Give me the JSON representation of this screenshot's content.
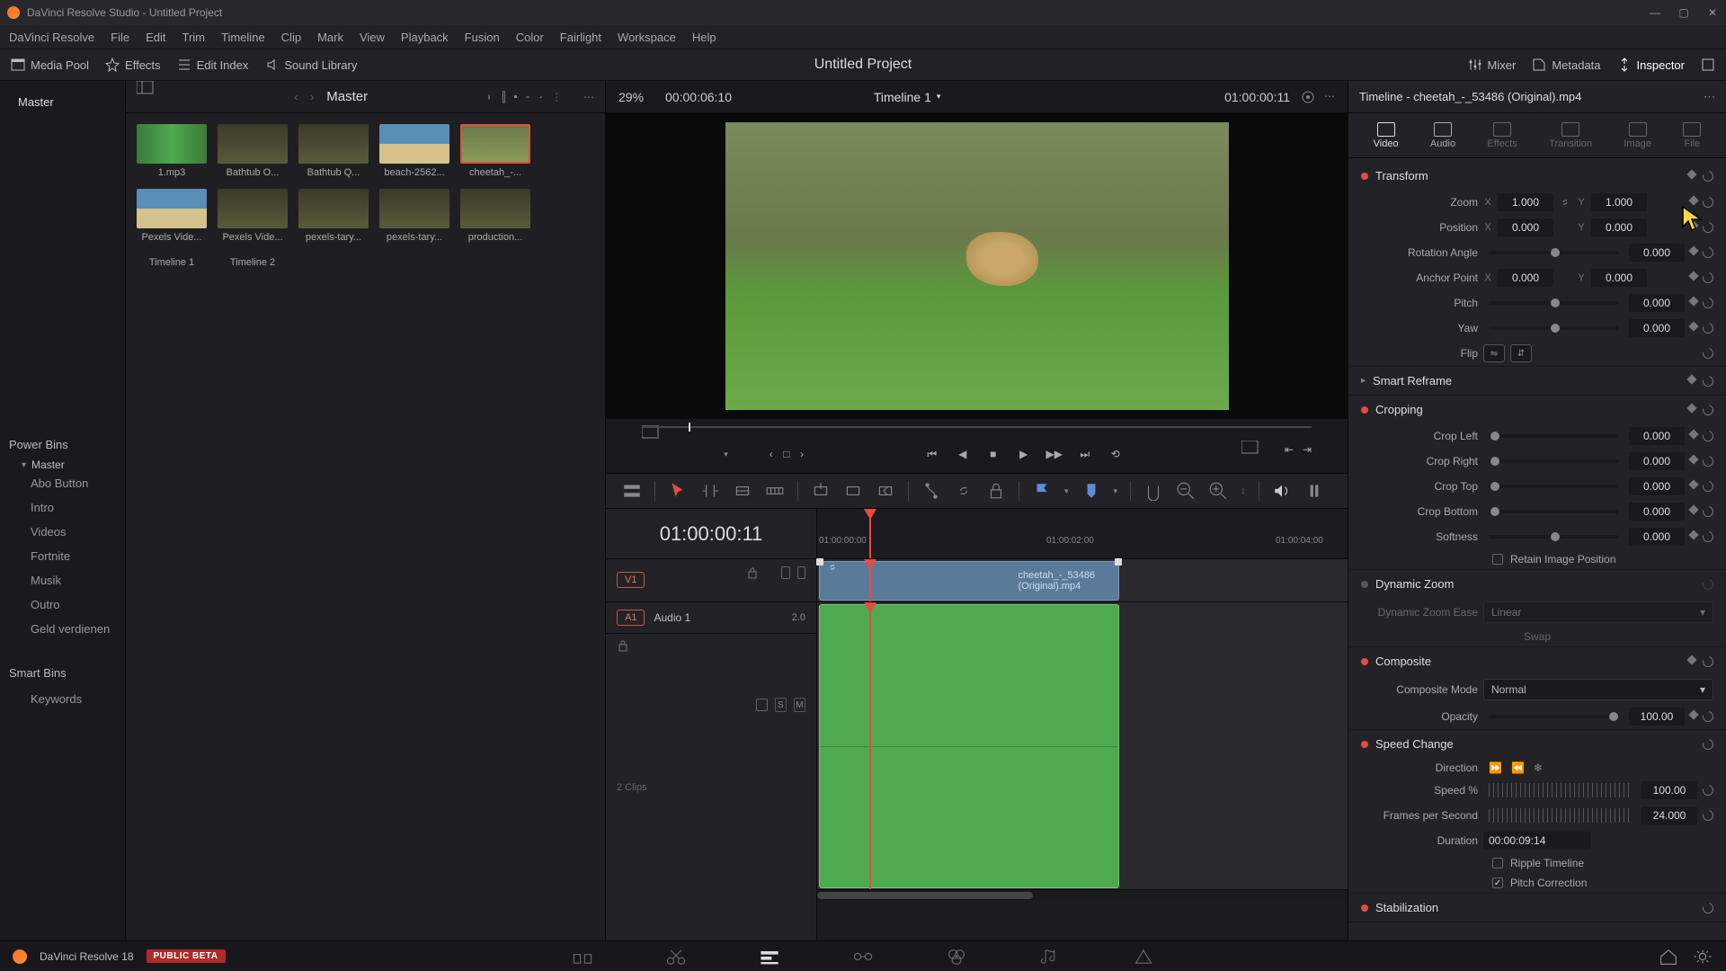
{
  "titlebar": {
    "text": "DaVinci Resolve Studio - Untitled Project"
  },
  "menu": [
    "DaVinci Resolve",
    "File",
    "Edit",
    "Trim",
    "Timeline",
    "Clip",
    "Mark",
    "View",
    "Playback",
    "Fusion",
    "Color",
    "Fairlight",
    "Workspace",
    "Help"
  ],
  "toolbar": {
    "media_pool": "Media Pool",
    "effects": "Effects",
    "edit_index": "Edit Index",
    "sound_library": "Sound Library",
    "mixer": "Mixer",
    "metadata": "Metadata",
    "inspector": "Inspector"
  },
  "project_title": "Untitled Project",
  "media": {
    "breadcrumb": "Master",
    "master_label": "Master",
    "clips": [
      {
        "name": "1.mp3",
        "kind": "audio"
      },
      {
        "name": "Bathtub O...",
        "kind": "forest"
      },
      {
        "name": "Bathtub Q...",
        "kind": "forest"
      },
      {
        "name": "beach-2562...",
        "kind": "beach"
      },
      {
        "name": "cheetah_-...",
        "kind": "cheetah"
      },
      {
        "name": "Pexels Vide...",
        "kind": "beach"
      },
      {
        "name": "Pexels Vide...",
        "kind": "forest"
      },
      {
        "name": "pexels-tary...",
        "kind": "forest"
      },
      {
        "name": "pexels-tary...",
        "kind": "forest"
      },
      {
        "name": "production...",
        "kind": "forest"
      },
      {
        "name": "Timeline 1",
        "kind": "timeline"
      },
      {
        "name": "Timeline 2",
        "kind": "timeline"
      }
    ]
  },
  "bins": {
    "power_title": "Power Bins",
    "power_master": "Master",
    "power_items": [
      "Abo Button",
      "Intro",
      "Videos",
      "Fortnite",
      "Musik",
      "Outro",
      "Geld verdienen"
    ],
    "smart_title": "Smart Bins",
    "smart_items": [
      "Keywords"
    ]
  },
  "viewer": {
    "zoom": "29%",
    "tc_left": "00:00:06:10",
    "timeline_name": "Timeline 1",
    "tc_right": "01:00:00:11"
  },
  "timeline": {
    "timecode": "01:00:00:11",
    "ruler": [
      "01:00:00:00",
      "01:00:02:00",
      "01:00:04:00"
    ],
    "v1": "V1",
    "a1": "A1",
    "audio_name": "Audio 1",
    "audio_ch": "2.0",
    "clips_count": "2 Clips",
    "s": "S",
    "m": "M",
    "video_clip": "cheetah_-_53486 (Original).mp4"
  },
  "inspector": {
    "header": "Timeline - cheetah_-_53486 (Original).mp4",
    "tabs": [
      "Video",
      "Audio",
      "Effects",
      "Transition",
      "Image",
      "File"
    ],
    "transform": {
      "title": "Transform",
      "zoom": "Zoom",
      "zx": "1.000",
      "zy": "1.000",
      "position": "Position",
      "px": "0.000",
      "py": "0.000",
      "rotation": "Rotation Angle",
      "rv": "0.000",
      "anchor": "Anchor Point",
      "ax": "0.000",
      "ay": "0.000",
      "pitch": "Pitch",
      "pv": "0.000",
      "yaw": "Yaw",
      "yv": "0.000",
      "flip": "Flip"
    },
    "smart_reframe": "Smart Reframe",
    "cropping": {
      "title": "Cropping",
      "left": "Crop Left",
      "lv": "0.000",
      "right": "Crop Right",
      "rv": "0.000",
      "top": "Crop Top",
      "tv": "0.000",
      "bottom": "Crop Bottom",
      "bv": "0.000",
      "softness": "Softness",
      "sv": "0.000",
      "retain": "Retain Image Position"
    },
    "dynamic_zoom": {
      "title": "Dynamic Zoom",
      "ease": "Dynamic Zoom Ease",
      "mode": "Linear",
      "swap": "Swap"
    },
    "composite": {
      "title": "Composite",
      "mode_lbl": "Composite Mode",
      "mode": "Normal",
      "opacity_lbl": "Opacity",
      "opacity": "100.00"
    },
    "speed": {
      "title": "Speed Change",
      "direction": "Direction",
      "speed_lbl": "Speed %",
      "speed": "100.00",
      "fps_lbl": "Frames per Second",
      "fps": "24.000",
      "duration_lbl": "Duration",
      "duration": "00:00:09:14",
      "ripple": "Ripple Timeline",
      "pitch": "Pitch Correction"
    },
    "stabilization": "Stabilization",
    "x": "X",
    "y": "Y"
  },
  "footer": {
    "app": "DaVinci Resolve 18",
    "beta": "PUBLIC BETA"
  }
}
